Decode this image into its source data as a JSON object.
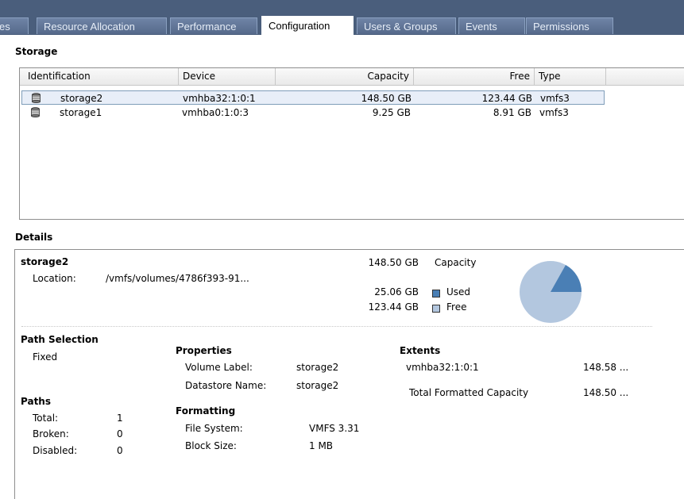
{
  "tabs": [
    {
      "label": "es"
    },
    {
      "label": "Resource Allocation"
    },
    {
      "label": "Performance"
    },
    {
      "label": "Configuration"
    },
    {
      "label": "Users & Groups"
    },
    {
      "label": "Events"
    },
    {
      "label": "Permissions"
    }
  ],
  "storage": {
    "title": "Storage",
    "columns": [
      "Identification",
      "Device",
      "Capacity",
      "Free",
      "Type"
    ],
    "rows": [
      {
        "id": "storage2",
        "device": "vmhba32:1:0:1",
        "capacity": "148.50 GB",
        "free": "123.44 GB",
        "type": "vmfs3",
        "selected": true,
        "icon": "database-icon"
      },
      {
        "id": "storage1",
        "device": "vmhba0:1:0:3",
        "capacity": "9.25 GB",
        "free": "8.91 GB",
        "type": "vmfs3",
        "selected": false,
        "icon": "database-icon"
      }
    ]
  },
  "details": {
    "title": "Details",
    "name": "storage2",
    "location_label": "Location:",
    "location_value": "/vmfs/volumes/4786f393-91...",
    "capacity_value": "148.50 GB",
    "capacity_label": "Capacity",
    "used_value": "25.06 GB",
    "used_label": "Used",
    "free_value": "123.44 GB",
    "free_label": "Free",
    "used_fraction": 0.1688,
    "colors": {
      "used": "#4a7fb5",
      "free": "#b3c7df"
    },
    "path_selection_title": "Path Selection",
    "path_selection_value": "Fixed",
    "paths_title": "Paths",
    "paths": [
      {
        "label": "Total:",
        "value": "1"
      },
      {
        "label": "Broken:",
        "value": "0"
      },
      {
        "label": "Disabled:",
        "value": "0"
      }
    ],
    "properties_title": "Properties",
    "volume_label_label": "Volume Label:",
    "volume_label_value": "storage2",
    "datastore_name_label": "Datastore Name:",
    "datastore_name_value": "storage2",
    "formatting_title": "Formatting",
    "file_system_label": "File System:",
    "file_system_value": "VMFS 3.31",
    "block_size_label": "Block Size:",
    "block_size_value": "1 MB",
    "extents_title": "Extents",
    "extent_device": "vmhba32:1:0:1",
    "extent_size": "148.58 ...",
    "total_formatted_label": "Total Formatted Capacity",
    "total_formatted_value": "148.50 ..."
  }
}
